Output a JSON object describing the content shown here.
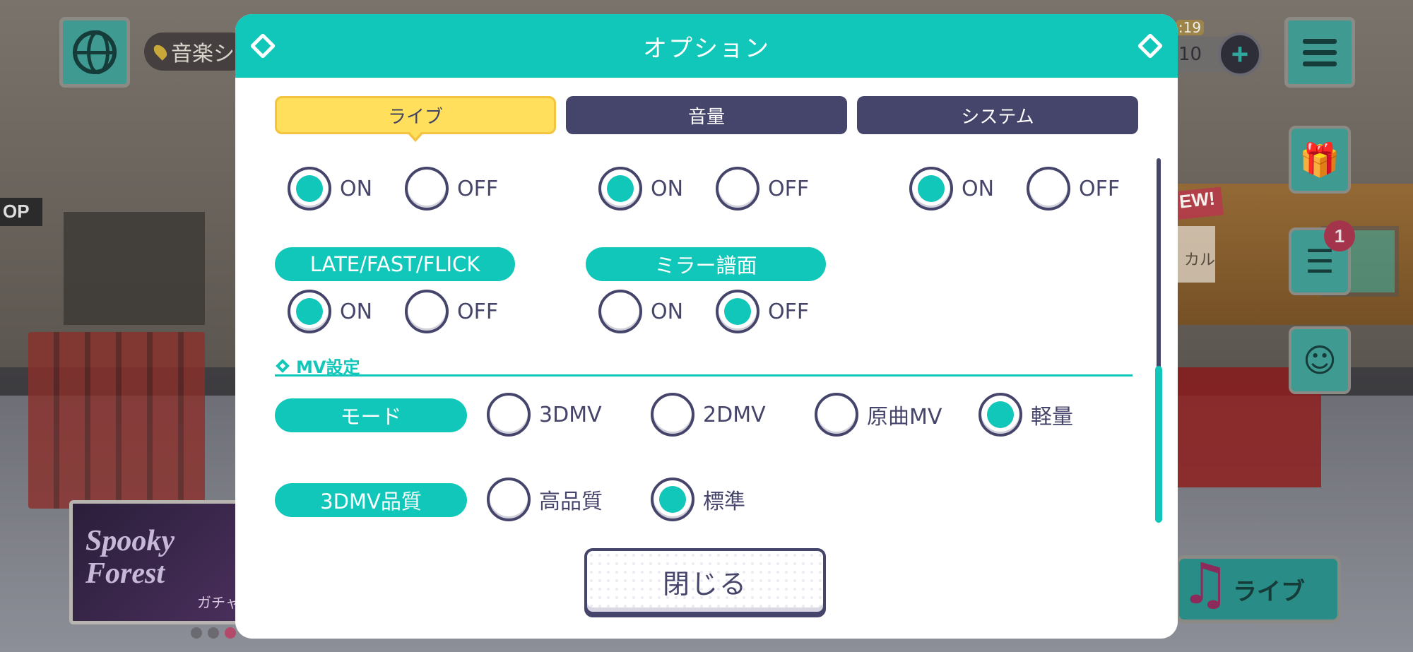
{
  "hud": {
    "location_label": "音楽シ",
    "time_label": ":19",
    "currency_value": "10",
    "notification_count": "1",
    "new_badge": "EW!",
    "side_card_label": "カル",
    "banner_title": "Spooky Forest",
    "banner_subtitle": "ガチャ",
    "live_button_label": "ライブ",
    "shop_sign": "OP"
  },
  "modal": {
    "title": "オプション",
    "tabs": [
      {
        "label": "ライブ",
        "active": true
      },
      {
        "label": "音量",
        "active": false
      },
      {
        "label": "システム",
        "active": false
      }
    ],
    "rows": {
      "top": [
        {
          "on_label": "ON",
          "off_label": "OFF",
          "selected": "ON"
        },
        {
          "on_label": "ON",
          "off_label": "OFF",
          "selected": "ON"
        },
        {
          "on_label": "ON",
          "off_label": "OFF",
          "selected": "ON"
        }
      ],
      "late_fast_flick": {
        "label": "LATE/FAST/FLICK",
        "on_label": "ON",
        "off_label": "OFF",
        "selected": "ON"
      },
      "mirror": {
        "label": "ミラー譜面",
        "on_label": "ON",
        "off_label": "OFF",
        "selected": "OFF"
      }
    },
    "mv_section": {
      "title": "MV設定",
      "mode": {
        "label": "モード",
        "options": [
          "3DMV",
          "2DMV",
          "原曲MV",
          "軽量"
        ],
        "selected": "軽量"
      },
      "quality": {
        "label": "3DMV品質",
        "options": [
          "高品質",
          "標準"
        ],
        "selected": "標準"
      }
    },
    "close_label": "閉じる"
  },
  "colors": {
    "accent": "#10c7b9",
    "dark": "#45446a",
    "active_tab": "#ffdf5b",
    "highlight_ring": "#e21616"
  }
}
